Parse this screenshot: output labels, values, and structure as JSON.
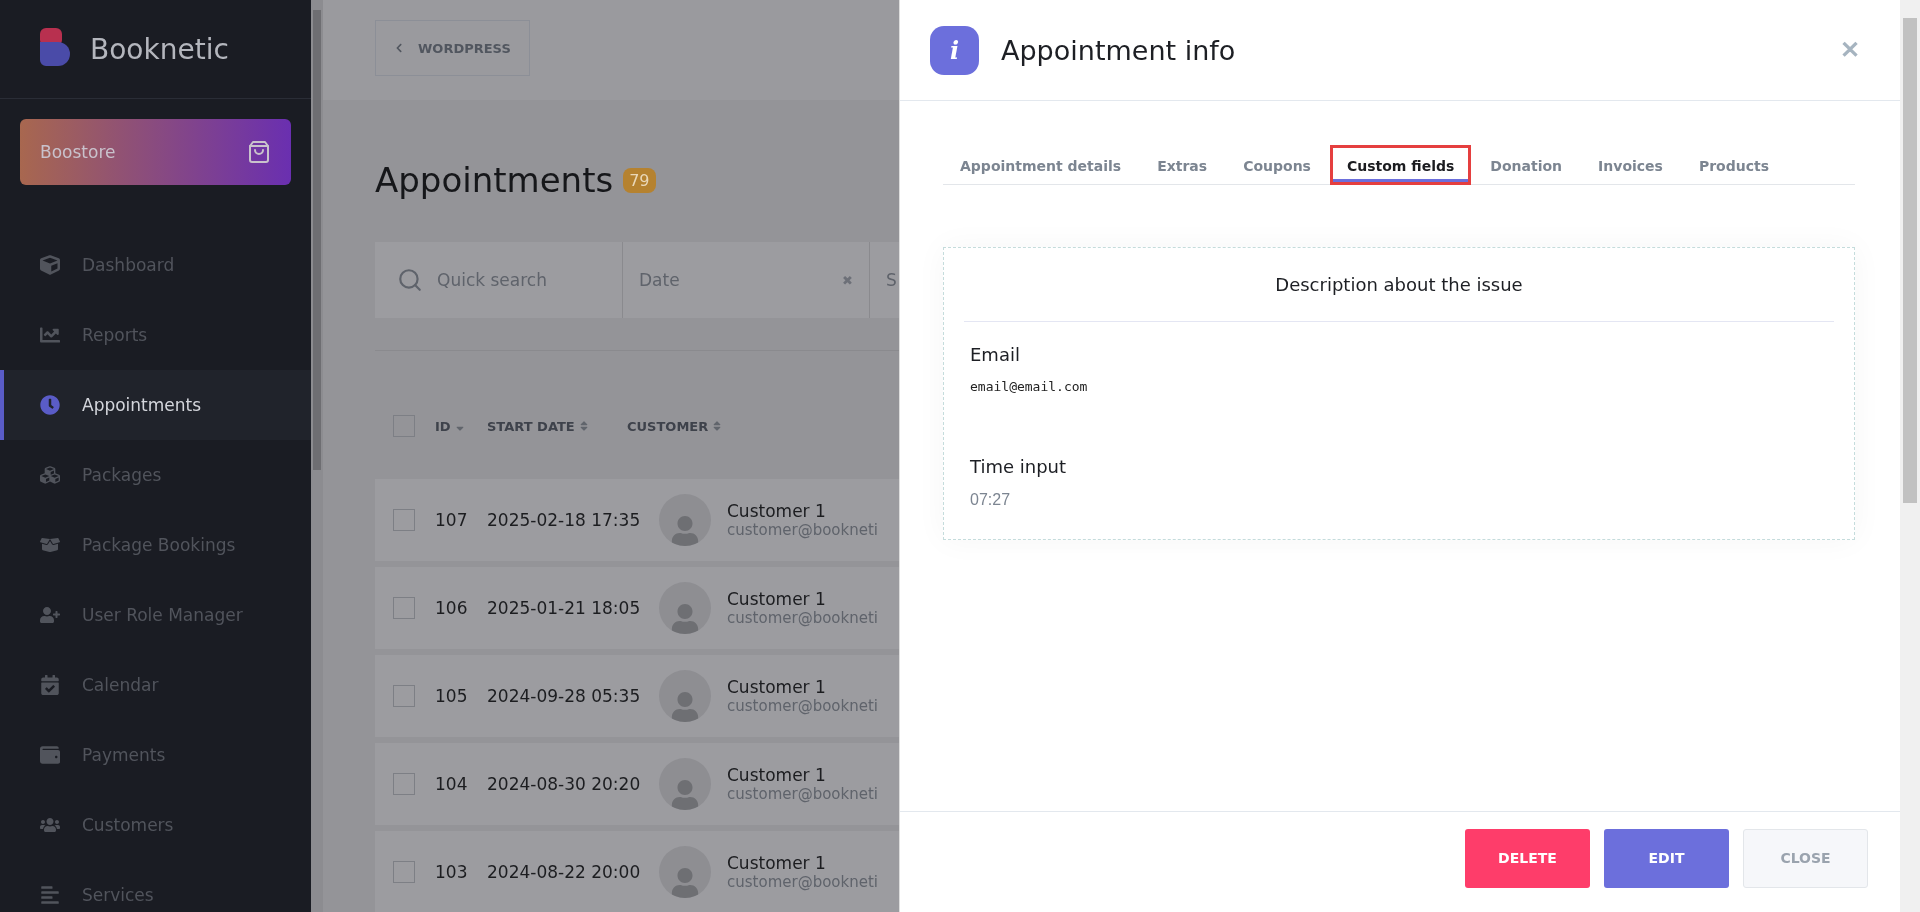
{
  "sidebar": {
    "brand": "Booknetic",
    "store_button": "Boostore",
    "items": [
      {
        "label": "Dashboard",
        "selected": false
      },
      {
        "label": "Reports",
        "selected": false
      },
      {
        "label": "Appointments",
        "selected": true
      },
      {
        "label": "Packages",
        "selected": false
      },
      {
        "label": "Package Bookings",
        "selected": false
      },
      {
        "label": "User Role Manager",
        "selected": false
      },
      {
        "label": "Calendar",
        "selected": false
      },
      {
        "label": "Payments",
        "selected": false
      },
      {
        "label": "Customers",
        "selected": false
      },
      {
        "label": "Services",
        "selected": false
      }
    ]
  },
  "main": {
    "back_button": "WORDPRESS",
    "title": "Appointments",
    "count": "79",
    "filters": {
      "search_placeholder": "Quick search",
      "date_placeholder": "Date",
      "clear": "✖",
      "next_filter": "S"
    },
    "table": {
      "select_all_checked": false,
      "columns": [
        {
          "label": "ID",
          "sorted": true
        },
        {
          "label": "START DATE",
          "sorted": false
        },
        {
          "label": "CUSTOMER",
          "sorted": false
        }
      ],
      "rows": [
        {
          "id": "107",
          "start_date": "2025-02-18 17:35",
          "customer": "Customer 1",
          "email": "customer@bookneti",
          "checked": false
        },
        {
          "id": "106",
          "start_date": "2025-01-21 18:05",
          "customer": "Customer 1",
          "email": "customer@bookneti",
          "checked": false
        },
        {
          "id": "105",
          "start_date": "2024-09-28 05:35",
          "customer": "Customer 1",
          "email": "customer@bookneti",
          "checked": false
        },
        {
          "id": "104",
          "start_date": "2024-08-30 20:20",
          "customer": "Customer 1",
          "email": "customer@bookneti",
          "checked": false
        },
        {
          "id": "103",
          "start_date": "2024-08-22 20:00",
          "customer": "Customer 1",
          "email": "customer@bookneti",
          "checked": false
        }
      ]
    }
  },
  "panel": {
    "title": "Appointment info",
    "icon_letter": "i",
    "close": "✕",
    "tabs": [
      {
        "label": "Appointment details",
        "selected": false,
        "highlighted": false
      },
      {
        "label": "Extras",
        "selected": false,
        "highlighted": false
      },
      {
        "label": "Coupons",
        "selected": false,
        "highlighted": false
      },
      {
        "label": "Custom fields",
        "selected": true,
        "highlighted": true
      },
      {
        "label": "Donation",
        "selected": false,
        "highlighted": false
      },
      {
        "label": "Invoices",
        "selected": false,
        "highlighted": false
      },
      {
        "label": "Products",
        "selected": false,
        "highlighted": false
      }
    ],
    "section_title": "Description about the issue",
    "fields": [
      {
        "label": "Email",
        "value": "email@email.com",
        "kind": "mono"
      },
      {
        "label": "Time input",
        "value": "07:27",
        "kind": "plain"
      }
    ],
    "buttons": [
      {
        "label": "DELETE",
        "kind": "danger"
      },
      {
        "label": "EDIT",
        "kind": "primary"
      },
      {
        "label": "CLOSE",
        "kind": "secondary"
      }
    ]
  }
}
